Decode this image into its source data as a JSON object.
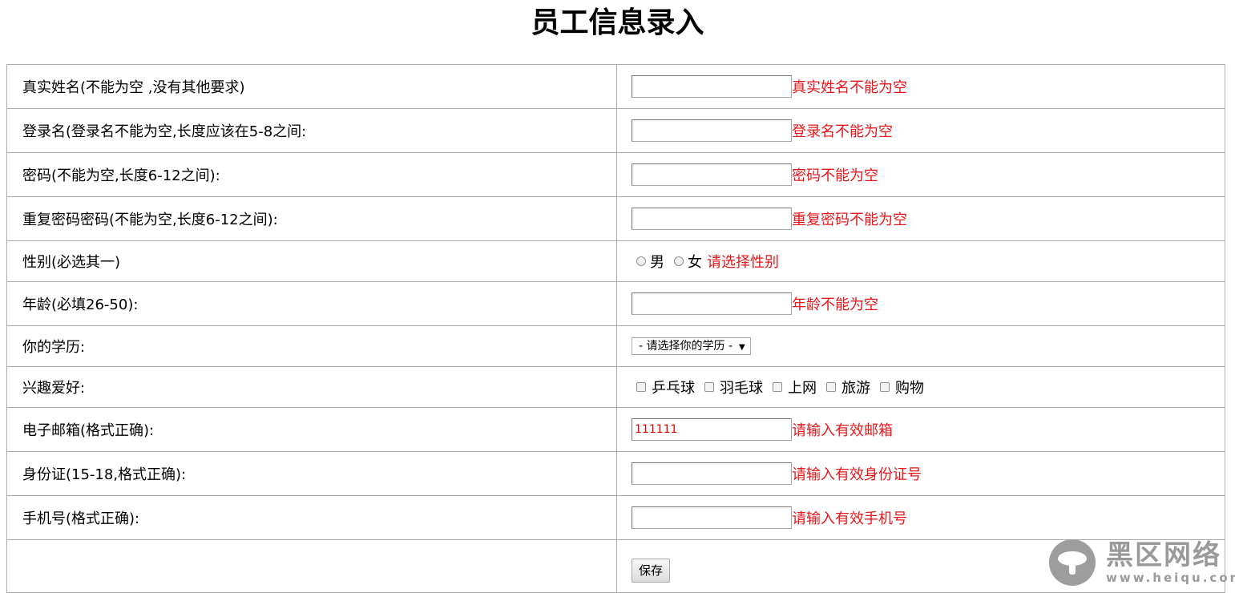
{
  "page": {
    "title": "员工信息录入"
  },
  "rows": {
    "realname": {
      "label": "真实姓名(不能为空 ,没有其他要求)",
      "value": "",
      "error": "真实姓名不能为空"
    },
    "loginname": {
      "label": "登录名(登录名不能为空,长度应该在5-8之间:",
      "value": "",
      "error": "登录名不能为空"
    },
    "password": {
      "label": "密码(不能为空,长度6-12之间):",
      "value": "",
      "error": "密码不能为空"
    },
    "repassword": {
      "label": "重复密码密码(不能为空,长度6-12之间):",
      "value": "",
      "error": "重复密码不能为空"
    },
    "gender": {
      "label": "性别(必选其一)",
      "options": [
        "男",
        "女"
      ],
      "error": "请选择性别"
    },
    "age": {
      "label": "年龄(必填26-50):",
      "value": "",
      "error": "年龄不能为空"
    },
    "education": {
      "label": "你的学历:",
      "selected": "- 请选择你的学历 -"
    },
    "hobbies": {
      "label": "兴趣爱好:",
      "options": [
        "乒乓球",
        "羽毛球",
        "上网",
        "旅游",
        "购物"
      ]
    },
    "email": {
      "label": "电子邮箱(格式正确):",
      "value": "111111",
      "error": "请输入有效邮箱"
    },
    "idcard": {
      "label": "身份证(15-18,格式正确):",
      "value": "",
      "error": "请输入有效身份证号"
    },
    "phone": {
      "label": "手机号(格式正确):",
      "value": "",
      "error": "请输入有效手机号"
    },
    "submit": {
      "label": "保存"
    }
  },
  "watermark": {
    "title": "黑区网络",
    "url": "www.heiqu.com"
  },
  "colors": {
    "error": "#e8161a",
    "border": "#a9a9a9"
  }
}
